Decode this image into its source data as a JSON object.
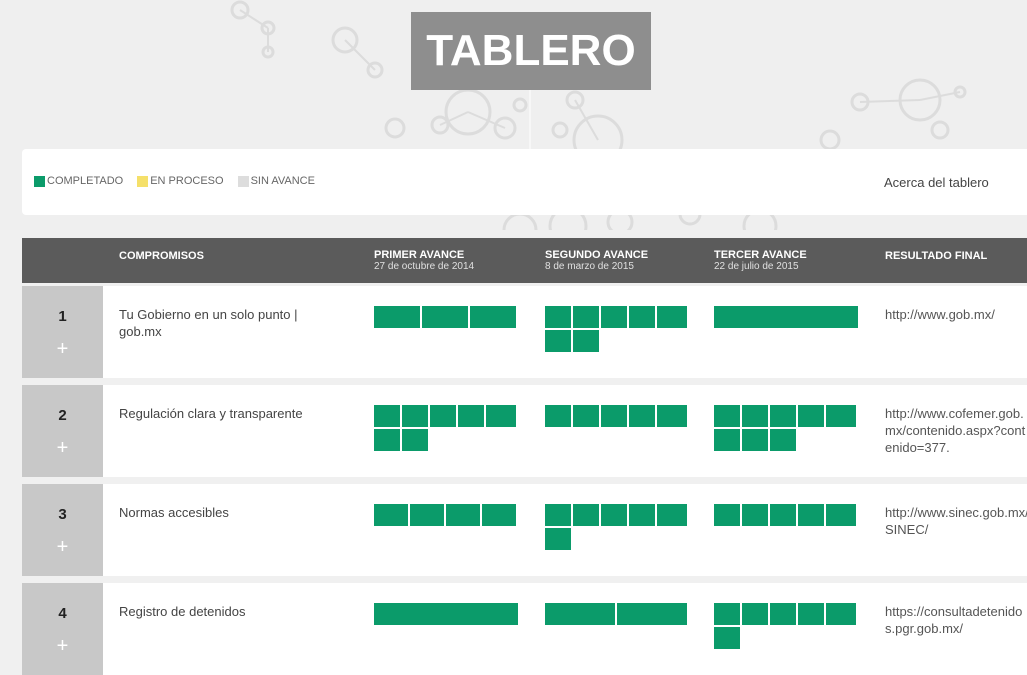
{
  "header": {
    "title": "TABLERO"
  },
  "legend": {
    "items": [
      {
        "label": "COMPLETADO",
        "color": "#0b9b6a"
      },
      {
        "label": "EN PROCESO",
        "color": "#f5e06a"
      },
      {
        "label": "SIN AVANCE",
        "color": "#dddddd"
      }
    ],
    "about_label": "Acerca del tablero"
  },
  "table": {
    "columns": {
      "compromisos": "COMPROMISOS",
      "primer": {
        "label": "PRIMER AVANCE",
        "date": "27 de octubre de 2014"
      },
      "segundo": {
        "label": "SEGUNDO AVANCE",
        "date": "8 de marzo de 2015"
      },
      "tercer": {
        "label": "TERCER AVANCE",
        "date": "22 de julio de 2015"
      },
      "resultado": "RESULTADO FINAL"
    },
    "rows": [
      {
        "number": "1",
        "expand": "+",
        "name": "Tu Gobierno en un solo punto | gob.mx",
        "url": "http://www.gob.mx/"
      },
      {
        "number": "2",
        "expand": "+",
        "name": "Regulación clara y transparente",
        "url": "http://www.cofemer.gob.mx/contenido.aspx?contenido=377."
      },
      {
        "number": "3",
        "expand": "+",
        "name": "Normas accesibles",
        "url": "http://www.sinec.gob.mx/SINEC/"
      },
      {
        "number": "4",
        "expand": "+",
        "name": "Registro de detenidos",
        "url": "https://consultadetenidos.pgr.gob.mx/"
      }
    ]
  }
}
